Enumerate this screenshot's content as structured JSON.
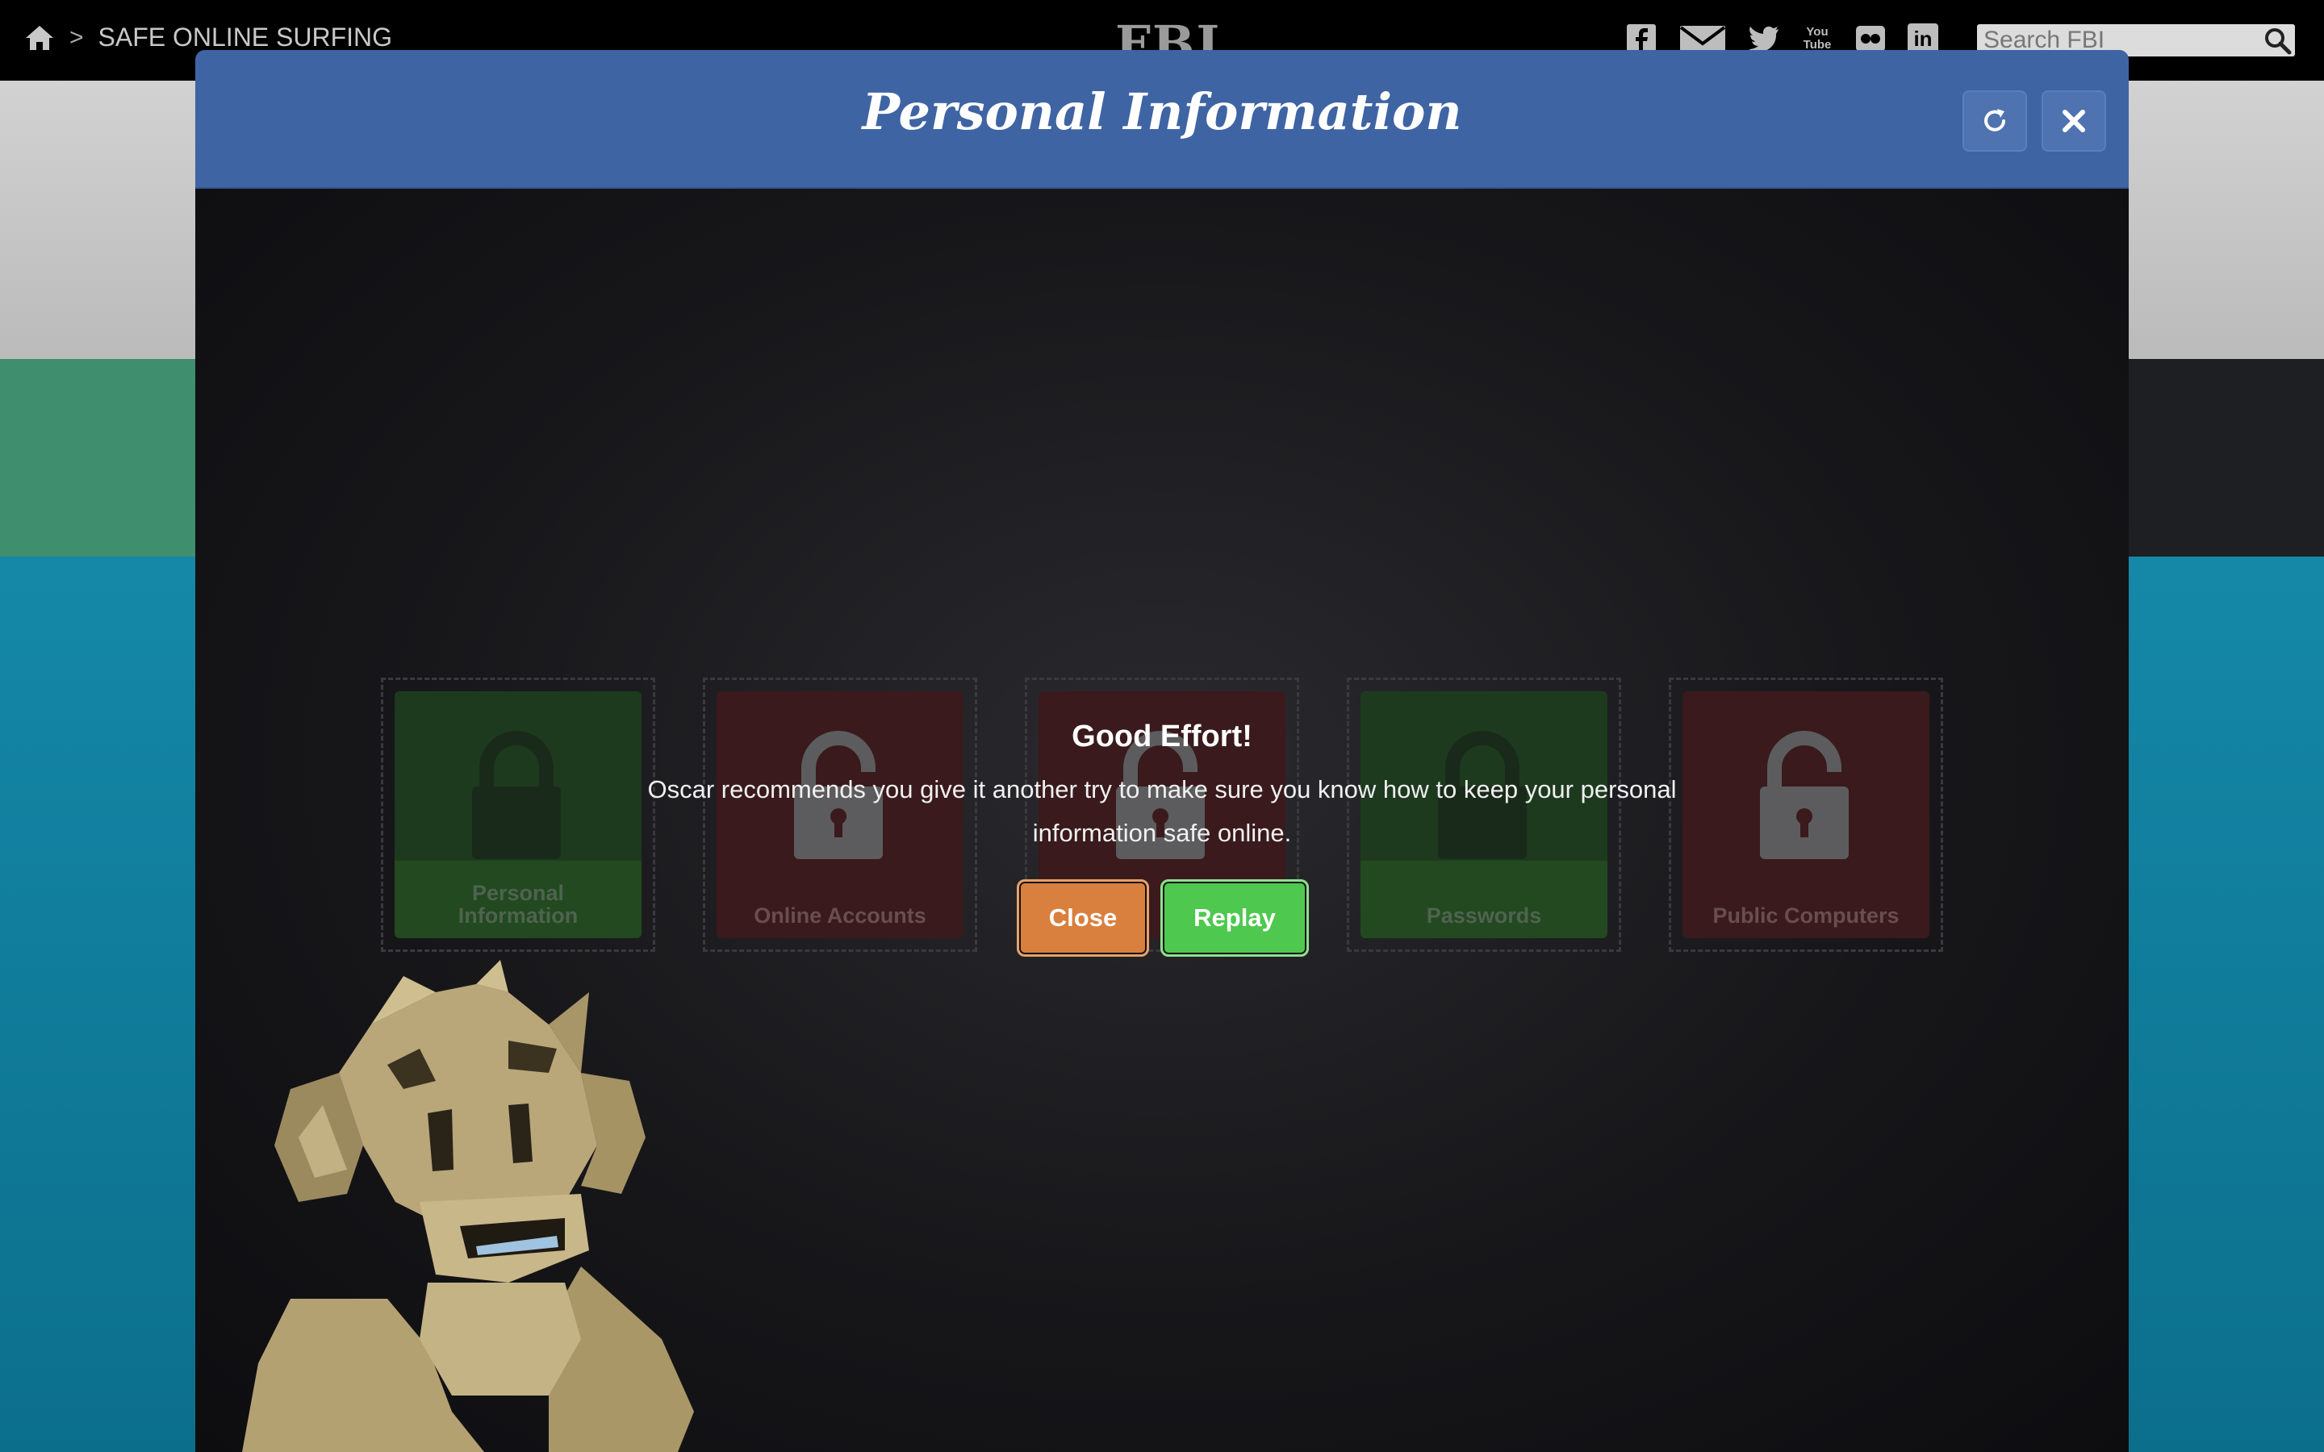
{
  "topbar": {
    "breadcrumb_sep": ">",
    "breadcrumb_current": "SAFE ONLINE SURFING",
    "logo": "FBI",
    "search_placeholder": "Search FBI",
    "social_icons": [
      "facebook-icon",
      "email-icon",
      "twitter-icon",
      "youtube-icon",
      "flickr-icon",
      "linkedin-icon"
    ],
    "youtube_text": "You Tube",
    "linkedin_text": "in"
  },
  "modal": {
    "title": "Personal Information",
    "cards": [
      {
        "label": "Personal Information",
        "state": "locked",
        "color": "green"
      },
      {
        "label": "Online Accounts",
        "state": "unlocked",
        "color": "red"
      },
      {
        "label": "",
        "state": "unlocked",
        "color": "red"
      },
      {
        "label": "Passwords",
        "state": "locked",
        "color": "green"
      },
      {
        "label": "Public Computers",
        "state": "unlocked",
        "color": "red"
      }
    ]
  },
  "dialog": {
    "title": "Good Effort!",
    "message": "Oscar recommends you give it another try to make sure you know how to keep your personal information safe online.",
    "close_label": "Close",
    "replay_label": "Replay"
  },
  "colors": {
    "header_blue": "#3f64a3",
    "close_orange": "#d9803f",
    "replay_green": "#4fc84f"
  }
}
